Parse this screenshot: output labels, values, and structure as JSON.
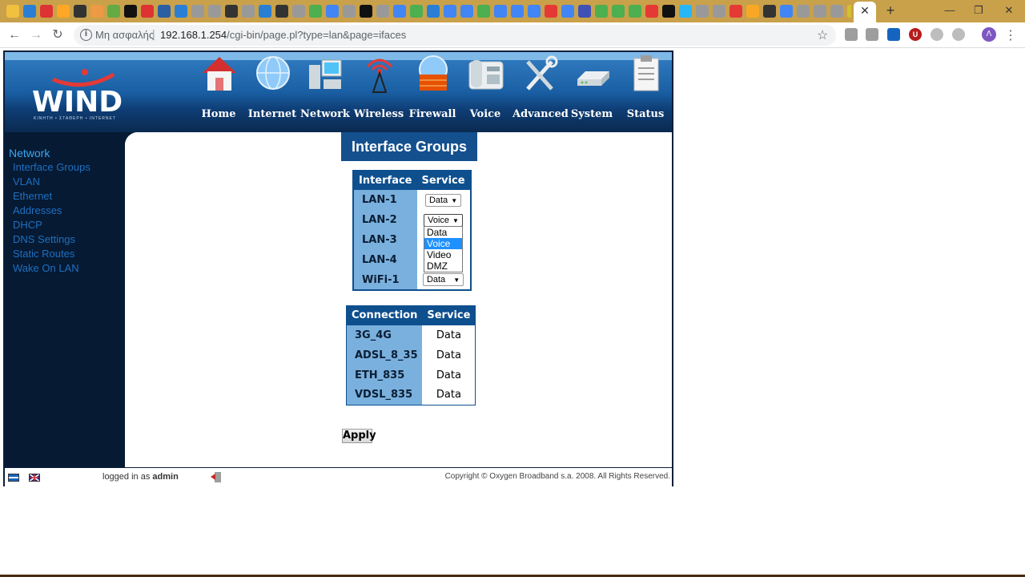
{
  "browser": {
    "tab_icon_colors": [
      "#f0c040",
      "#2a7fd4",
      "#d33",
      "#ffa726",
      "#333",
      "#e94",
      "#6a4",
      "#111",
      "#d33",
      "#2a5fa4",
      "#2a7fd4",
      "#999",
      "#999",
      "#333",
      "#999",
      "#2a7fd4",
      "#333",
      "#999",
      "#4caf50",
      "#4285f4",
      "#999",
      "#111",
      "#999",
      "#4285f4",
      "#4caf50",
      "#2a7fd4",
      "#4285f4",
      "#4285f4",
      "#4caf50",
      "#4285f4",
      "#4285f4",
      "#4285f4",
      "#e53935",
      "#4285f4",
      "#3f51b5",
      "#4caf50",
      "#4caf50",
      "#4caf50",
      "#e53935",
      "#111",
      "#29b6f6",
      "#999",
      "#999",
      "#e53935",
      "#f9a825",
      "#333",
      "#4285f4",
      "#999",
      "#999",
      "#999",
      "#d4c030",
      "#111",
      "#e53935",
      "#ff5722",
      "#333"
    ],
    "security_label": "Μη ασφαλής",
    "url_host": "192.168.1.254",
    "url_path": "/cgi-bin/page.pl?type=lan&page=ifaces",
    "avatar_initial": "Λ",
    "ext_colors": [
      "#9e9e9e",
      "#9e9e9e",
      "#1565c0",
      "#b71c1c",
      "#bdbdbd",
      "#bdbdbd"
    ],
    "ext_u_label": "U"
  },
  "router": {
    "logo_text": "WIND",
    "logo_sub": "ΚΙΝΗΤΗ • ΣΤΑΘΕΡΗ • INTERNET",
    "nav": [
      {
        "label": "Home",
        "icon": "house-icon"
      },
      {
        "label": "Internet",
        "icon": "globe-icon"
      },
      {
        "label": "Network",
        "icon": "computers-icon"
      },
      {
        "label": "Wireless",
        "icon": "antenna-icon"
      },
      {
        "label": "Firewall",
        "icon": "firewall-globe-icon"
      },
      {
        "label": "Voice",
        "icon": "phone-icon"
      },
      {
        "label": "Advanced",
        "icon": "tools-icon"
      },
      {
        "label": "System",
        "icon": "modem-icon"
      },
      {
        "label": "Status",
        "icon": "clipboard-icon"
      }
    ],
    "sidebar": {
      "title": "Network",
      "items": [
        "Interface Groups",
        "VLAN",
        "Ethernet",
        "Addresses",
        "DHCP",
        "DNS Settings",
        "Static Routes",
        "Wake On LAN"
      ]
    },
    "page_title": "Interface Groups",
    "interfaces": {
      "headers": [
        "Interface",
        "Service"
      ],
      "rows": [
        {
          "name": "LAN-1",
          "service": "Data"
        },
        {
          "name": "LAN-2",
          "service": "Voice"
        },
        {
          "name": "LAN-3",
          "service": ""
        },
        {
          "name": "LAN-4",
          "service": ""
        },
        {
          "name": "WiFi-1",
          "service": "Data"
        }
      ],
      "dropdown_options": [
        "Data",
        "Voice",
        "Video",
        "DMZ"
      ],
      "dropdown_highlighted": "Voice"
    },
    "connections": {
      "headers": [
        "Connection",
        "Service"
      ],
      "rows": [
        {
          "name": "3G_4G",
          "service": "Data"
        },
        {
          "name": "ADSL_8_35",
          "service": "Data"
        },
        {
          "name": "ETH_835",
          "service": "Data"
        },
        {
          "name": "VDSL_835",
          "service": "Data"
        }
      ]
    },
    "apply_label": "Apply",
    "footer": {
      "logged_in_prefix": "logged in as",
      "user": "admin",
      "copyright": "Copyright © Oxygen Broadband s.a. 2008. All Rights Reserved."
    }
  }
}
